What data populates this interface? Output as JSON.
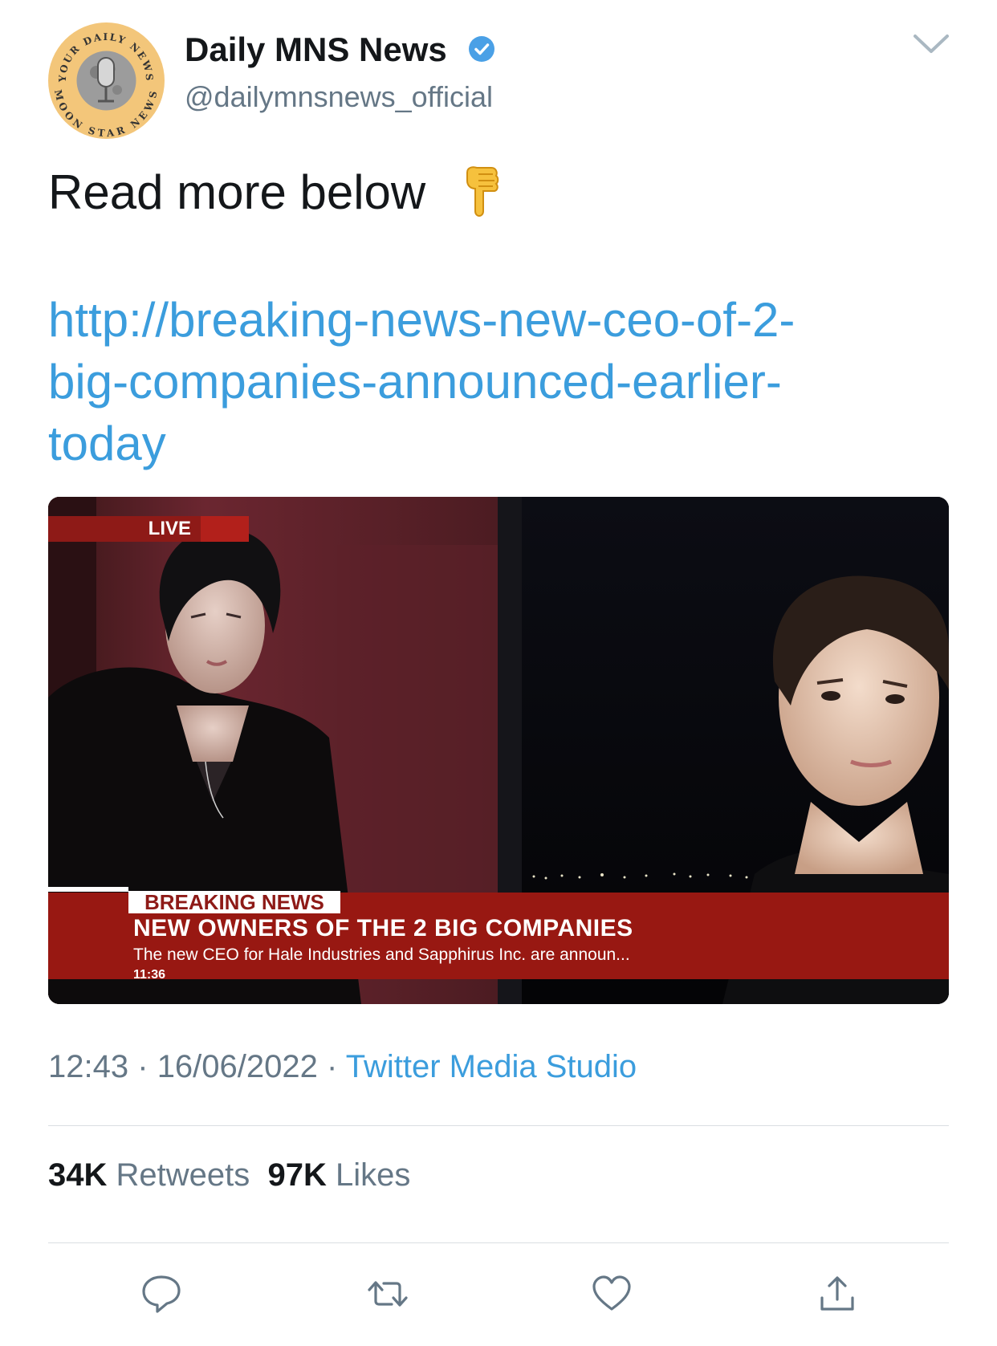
{
  "author": {
    "display_name": "Daily MNS News",
    "handle": "@dailymnsnews_official",
    "verified": true,
    "avatar_text_top": "YOUR DAILY NEWS",
    "avatar_text_bottom": "MOON STAR NEWS"
  },
  "tweet": {
    "text": "Read more below",
    "emoji": "backhand-index-pointing-down",
    "link_lines": [
      "http://breaking-news-new-ceo-of-2-",
      "big-companies-announced-earlier-",
      "today"
    ]
  },
  "media": {
    "live_label": "LIVE",
    "breaking_label": "BREAKING NEWS",
    "headline": "NEW OWNERS OF THE 2 BIG COMPANIES",
    "subline": "The new CEO for Hale Industries and Sapphirus Inc. are announ...",
    "time": "11:36"
  },
  "meta": {
    "time": "12:43",
    "date": "16/06/2022",
    "separator": "·",
    "source": "Twitter Media Studio"
  },
  "stats": {
    "retweets_count": "34K",
    "retweets_label": "Retweets",
    "likes_count": "97K",
    "likes_label": "Likes"
  },
  "colors": {
    "link": "#3b9ddd",
    "secondary_text": "#657786",
    "verified": "#4aa0e6",
    "news_red": "#981812"
  },
  "actions": [
    "reply-icon",
    "retweet-icon",
    "like-icon",
    "share-icon"
  ]
}
